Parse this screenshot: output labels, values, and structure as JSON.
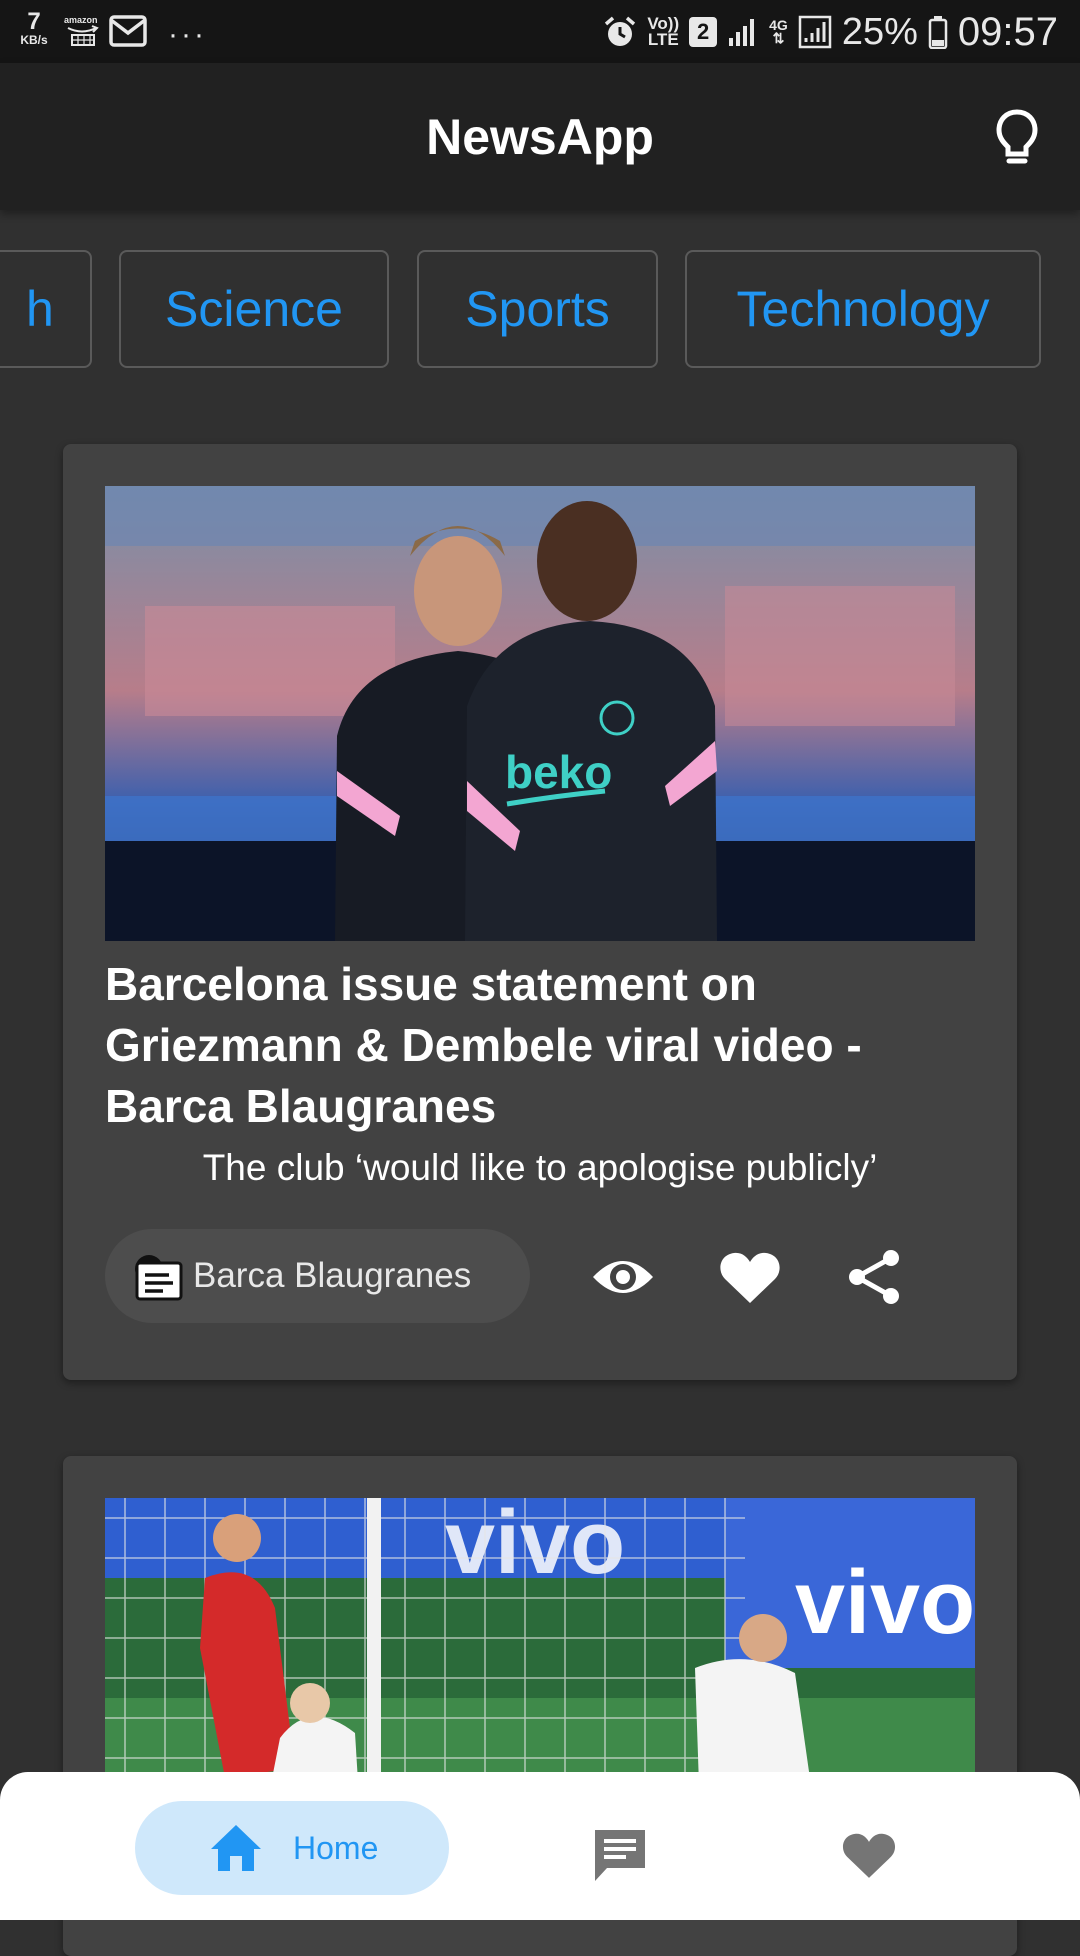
{
  "status_bar": {
    "net_speed_value": "7",
    "net_speed_unit": "KB/s",
    "amazon_label": "amazon",
    "dots": "···",
    "volte_top": "Vo))",
    "volte_bottom": "LTE",
    "sim_number": "2",
    "network_type": "4G",
    "battery_percent": "25%",
    "time": "09:57"
  },
  "app_bar": {
    "title": "NewsApp",
    "theme_icon": "lightbulb-icon"
  },
  "categories": [
    {
      "label": "h",
      "state": "partially-scrolled"
    },
    {
      "label": "Science"
    },
    {
      "label": "Sports"
    },
    {
      "label": "Technology"
    }
  ],
  "articles": [
    {
      "image_desc": "Two football players in Barcelona training tops",
      "title_lines": [
        "Barcelona issue statement on",
        "Griezmann & Dembele viral video -",
        "Barca Blaugranes"
      ],
      "description": "The club ‘would like to apologise publicly’",
      "source": "Barca Blaugranes",
      "actions": [
        "eye-icon",
        "heart-icon",
        "share-icon"
      ]
    },
    {
      "image_desc": "Football match goal celebration in front of a goal net"
    }
  ],
  "bottom_nav": {
    "items": [
      {
        "label": "Home",
        "icon": "home-icon",
        "active": true
      },
      {
        "label": "",
        "icon": "chat-icon",
        "active": false
      },
      {
        "label": "",
        "icon": "heart-icon",
        "active": false
      }
    ]
  },
  "colors": {
    "accent": "#2196f3",
    "background": "#303030",
    "appbar": "#212121",
    "card": "#424242",
    "nav_active_bg": "#cfe8fb"
  }
}
